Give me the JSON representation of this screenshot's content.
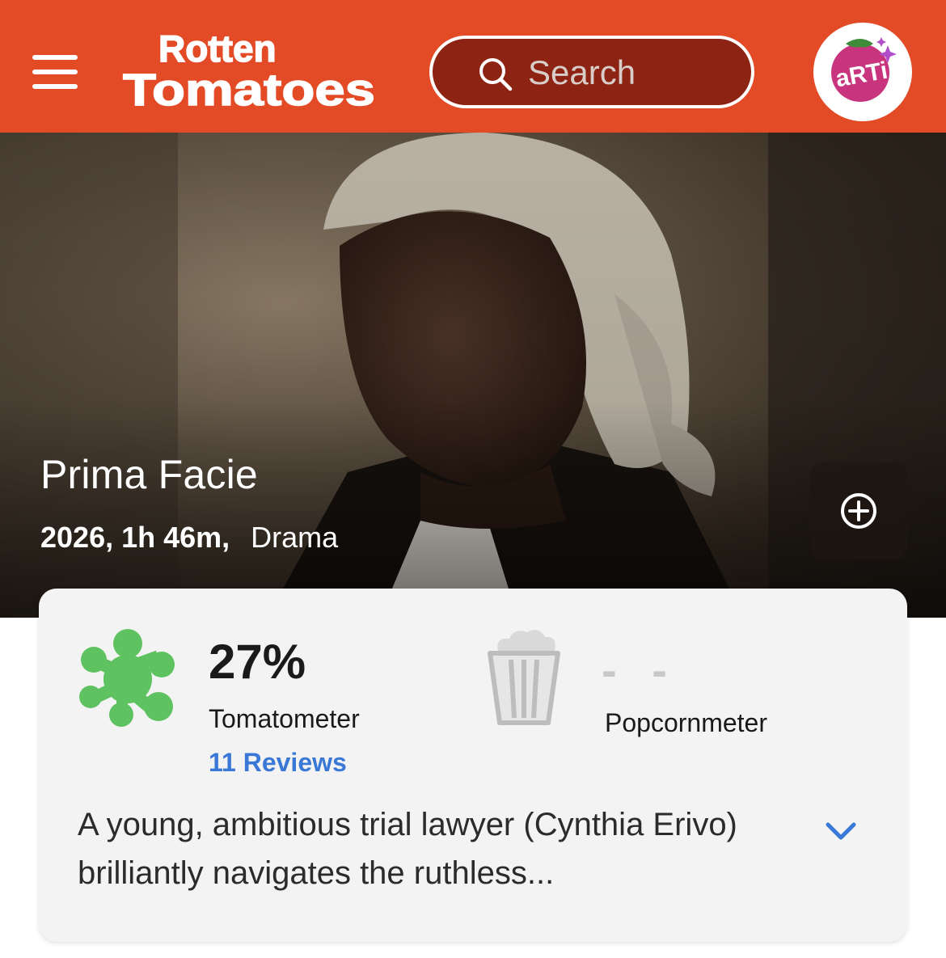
{
  "header": {
    "logo_line1": "Rotten",
    "logo_line2": "Tomatoes",
    "search_placeholder": "Search",
    "avatar_text": "aRTi",
    "brand_color": "#e34a26"
  },
  "hero": {
    "title": "Prima Facie",
    "year_runtime": "2026, 1h 46m",
    "separator": ",",
    "genre": "Drama"
  },
  "scores": {
    "tomatometer_value": "27%",
    "tomatometer_label": "Tomatometer",
    "reviews_link": "11 Reviews",
    "popcornmeter_value": "- -",
    "popcornmeter_label": "Popcornmeter",
    "splat_color": "#5fc260",
    "link_color": "#3978d6"
  },
  "synopsis": {
    "text": "A young, ambitious trial lawyer (Cynthia Erivo) brilliantly navigates the ruthless..."
  },
  "icons": {
    "menu": "hamburger-icon",
    "search": "search-icon",
    "add": "plus-circle-icon",
    "tomatometer": "green-splat-icon",
    "popcornmeter": "empty-popcorn-bucket-icon",
    "expand": "chevron-down-icon"
  }
}
